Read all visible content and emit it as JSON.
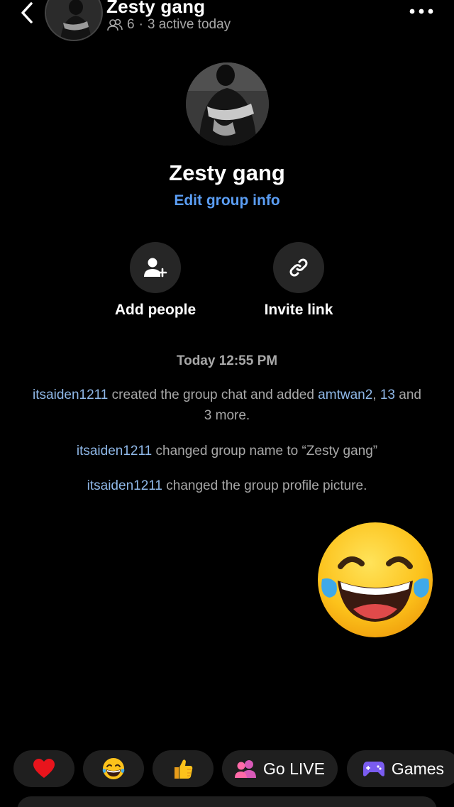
{
  "header": {
    "title": "Zesty gang",
    "member_count": "6",
    "separator": "·",
    "active_text": "3 active today"
  },
  "group": {
    "name": "Zesty gang",
    "edit_label": "Edit group info"
  },
  "actions": {
    "add_people": "Add people",
    "invite_link": "Invite link"
  },
  "messages": {
    "timestamp": "Today 12:55 PM",
    "sys1": {
      "user": "itsaiden1211",
      "text_a": " created the group chat and added ",
      "user2": "amtwan2",
      "comma": ", ",
      "user3": "13",
      "text_b": " and 3 more."
    },
    "sys2": {
      "user": "itsaiden1211",
      "text": " changed group name to “Zesty gang”"
    },
    "sys3": {
      "user": "itsaiden1211",
      "text": " changed the group profile picture."
    }
  },
  "quick_bar": {
    "go_live": "Go LIVE",
    "games": "Games"
  },
  "colors": {
    "background": "#000000",
    "link_blue": "#5b9ef5",
    "username_blue": "#8fb8e8",
    "muted_text": "#a8a8a8",
    "pill_bg": "#1f1f1f"
  },
  "icons": [
    "back-chevron-icon",
    "people-icon",
    "more-icon",
    "add-person-icon",
    "link-icon",
    "heart-icon",
    "laughing-emoji-icon",
    "thumbs-up-icon",
    "group-live-icon",
    "gamepad-icon"
  ]
}
